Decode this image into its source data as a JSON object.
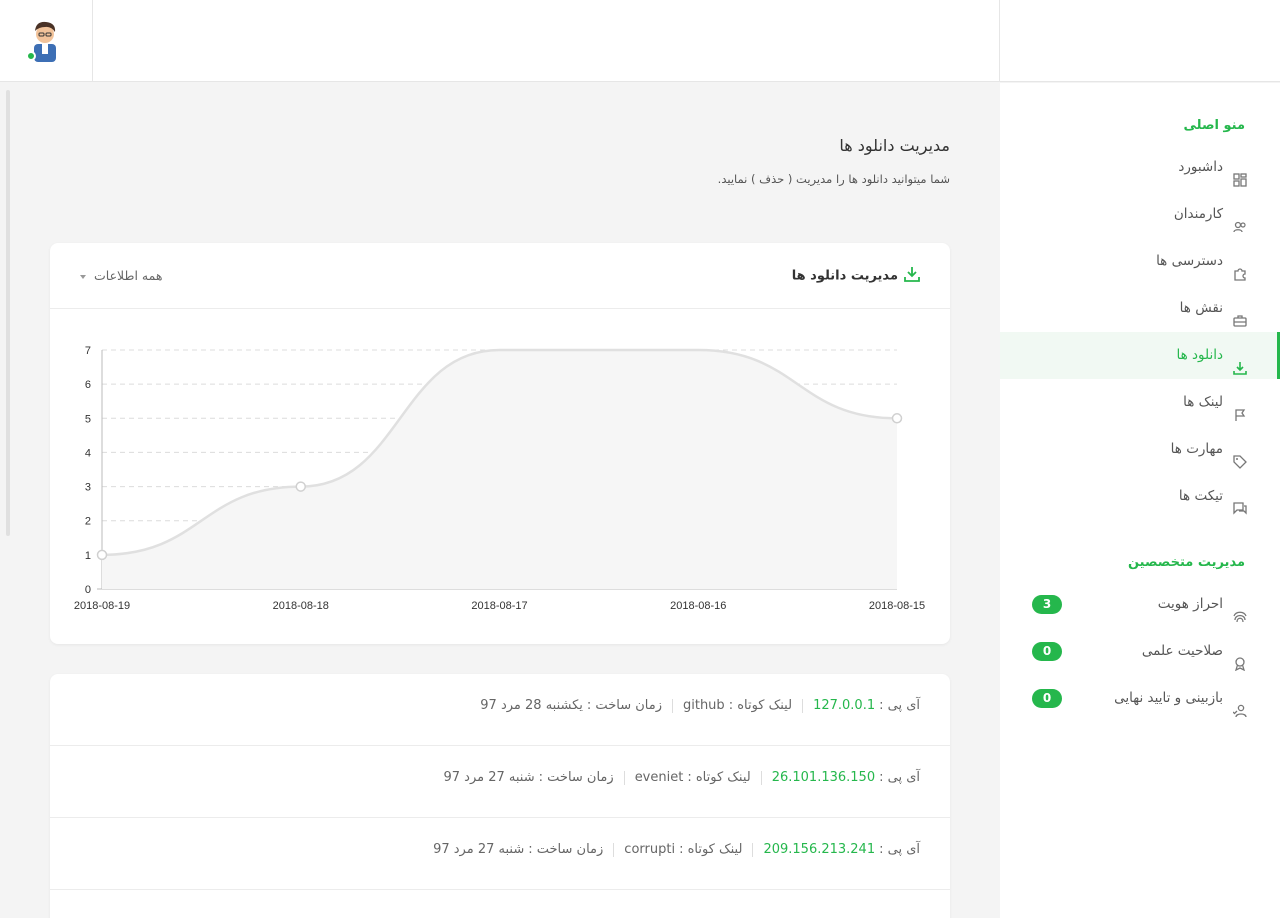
{
  "sidebar": {
    "section_main": "منو اصلی",
    "items": [
      {
        "label": "داشبورد",
        "icon": "dashboard-icon"
      },
      {
        "label": "کارمندان",
        "icon": "users-icon"
      },
      {
        "label": "دسترسی ها",
        "icon": "puzzle-icon"
      },
      {
        "label": "نقش ها",
        "icon": "briefcase-icon"
      },
      {
        "label": "دانلود ها",
        "icon": "download-icon",
        "active": true
      },
      {
        "label": "لینک ها",
        "icon": "flag-icon"
      },
      {
        "label": "مهارت ها",
        "icon": "tag-icon"
      },
      {
        "label": "تیکت ها",
        "icon": "chat-icon"
      }
    ],
    "section_experts": "مدیریت متخصصین",
    "expert_items": [
      {
        "label": "احراز هویت",
        "icon": "fingerprint-icon",
        "badge": "3"
      },
      {
        "label": "صلاحیت علمی",
        "icon": "award-icon",
        "badge": "0"
      },
      {
        "label": "بازبینی و تایید نهایی",
        "icon": "user-check-icon",
        "badge": "0"
      }
    ]
  },
  "page": {
    "title": "مدیریت دانلود ها",
    "subtitle": "شما میتوانید دانلود ها را مدیریت ( حذف ) نمایید."
  },
  "chart_card": {
    "title": "مدیریت دانلود ها",
    "filter": "همه اطلاعات"
  },
  "chart_data": {
    "type": "area",
    "x": [
      "2018-08-19",
      "2018-08-18",
      "2018-08-17",
      "2018-08-16",
      "2018-08-15"
    ],
    "values": [
      1,
      3,
      7,
      7,
      5
    ],
    "ylim": [
      0,
      7
    ],
    "yticks": [
      "0",
      "1",
      "2",
      "3",
      "4",
      "5",
      "6",
      "7"
    ],
    "grid": true,
    "color": "#e0e0e0"
  },
  "downloads": [
    {
      "ip_label": "آی پی :",
      "ip": "127.0.0.1",
      "link_label": "لینک کوتاه :",
      "link": "github",
      "time_label": "زمان ساخت :",
      "time": "یکشنبه 28 مرد 97"
    },
    {
      "ip_label": "آی پی :",
      "ip": "26.101.136.150",
      "link_label": "لینک کوتاه :",
      "link": "eveniet",
      "time_label": "زمان ساخت :",
      "time": "شنبه 27 مرد 97"
    },
    {
      "ip_label": "آی پی :",
      "ip": "209.156.213.241",
      "link_label": "لینک کوتاه :",
      "link": "corrupti",
      "time_label": "زمان ساخت :",
      "time": "شنبه 27 مرد 97"
    }
  ],
  "colors": {
    "accent": "#25b74c"
  }
}
